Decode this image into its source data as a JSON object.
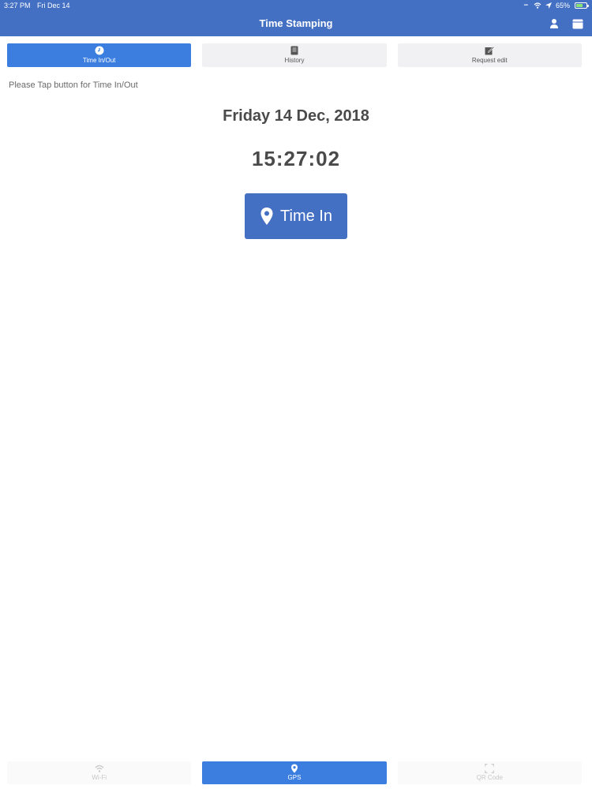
{
  "status_bar": {
    "time": "3:27 PM",
    "date": "Fri Dec 14",
    "battery": "65%",
    "battery_level": 0.65
  },
  "nav": {
    "title": "Time Stamping",
    "icons": [
      "person-icon",
      "calendar-icon"
    ]
  },
  "tabs": [
    {
      "label": "Time In/Out",
      "icon": "clock-icon",
      "active": true
    },
    {
      "label": "History",
      "icon": "book-icon",
      "active": false
    },
    {
      "label": "Request edit",
      "icon": "edit-icon",
      "active": false
    }
  ],
  "main": {
    "instruction": "Please Tap button for Time In/Out",
    "date": "Friday 14 Dec, 2018",
    "time": "15:27:02",
    "button_label": "Time In",
    "button_icon": "map-pin-icon"
  },
  "bottom_tabs": [
    {
      "label": "Wi-Fi",
      "icon": "wifi-icon",
      "active": false
    },
    {
      "label": "GPS",
      "icon": "map-pin-icon",
      "active": true
    },
    {
      "label": "QR Code",
      "icon": "qr-scan-icon",
      "active": false
    }
  ],
  "colors": {
    "primary": "#4470c4",
    "tab_active": "#3b7ee0",
    "tab_inactive": "#f1f1f3",
    "text": "#4a4a4a"
  }
}
